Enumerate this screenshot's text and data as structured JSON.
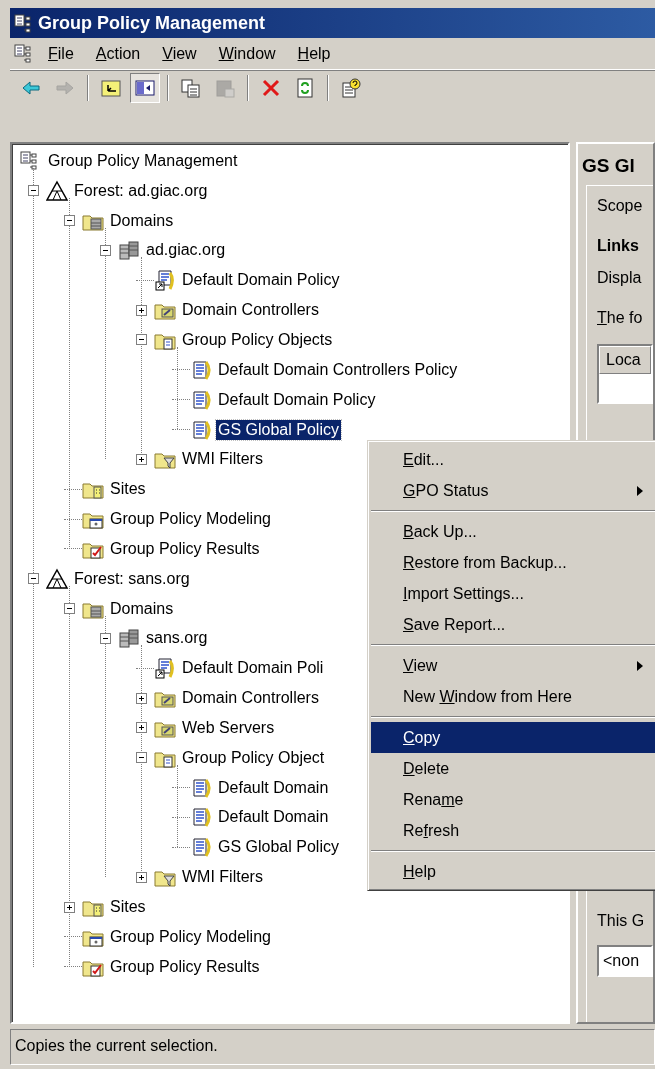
{
  "window": {
    "title": "Group Policy Management"
  },
  "menu_bar": [
    {
      "key": "F",
      "post": "ile"
    },
    {
      "key": "A",
      "post": "ction"
    },
    {
      "key": "V",
      "post": "iew"
    },
    {
      "key": "W",
      "post": "indow"
    },
    {
      "key": "H",
      "post": "elp"
    }
  ],
  "toolbar": [
    {
      "kind": "back",
      "disabled": false,
      "pressed": false
    },
    {
      "kind": "forward",
      "disabled": true,
      "pressed": false
    },
    {
      "kind": "separator"
    },
    {
      "kind": "up",
      "disabled": false,
      "pressed": false
    },
    {
      "kind": "show-tree",
      "disabled": false,
      "pressed": true
    },
    {
      "kind": "separator"
    },
    {
      "kind": "copy",
      "disabled": false,
      "pressed": false
    },
    {
      "kind": "paste",
      "disabled": true,
      "pressed": false
    },
    {
      "kind": "separator"
    },
    {
      "kind": "delete",
      "disabled": false,
      "pressed": false
    },
    {
      "kind": "refresh",
      "disabled": false,
      "pressed": false
    },
    {
      "kind": "separator"
    },
    {
      "kind": "help",
      "disabled": false,
      "pressed": false
    }
  ],
  "tree": [
    {
      "label": "Group Policy Management",
      "kind": "root",
      "selected": false,
      "children": [
        {
          "label": "Forest: ad.giac.org",
          "kind": "forest",
          "expanded": true,
          "selected": false,
          "children": [
            {
              "label": "Domains",
              "kind": "domains",
              "expanded": true,
              "selected": false,
              "children": [
                {
                  "label": "ad.giac.org",
                  "kind": "domain",
                  "expanded": true,
                  "selected": false,
                  "children": [
                    {
                      "label": "Default Domain Policy",
                      "kind": "gpo-link",
                      "selected": false
                    },
                    {
                      "label": "Domain Controllers",
                      "kind": "ou",
                      "expanded": false,
                      "selected": false
                    },
                    {
                      "label": "Group Policy Objects",
                      "kind": "gpo-folder",
                      "expanded": true,
                      "selected": false,
                      "children": [
                        {
                          "label": "Default Domain Controllers Policy",
                          "kind": "gpo",
                          "selected": false
                        },
                        {
                          "label": "Default Domain Policy",
                          "kind": "gpo",
                          "selected": false
                        },
                        {
                          "label": "GS Global Policy",
                          "kind": "gpo",
                          "selected": true
                        }
                      ]
                    },
                    {
                      "label": "WMI Filters",
                      "kind": "wmi",
                      "expanded": false,
                      "selected": false
                    }
                  ]
                }
              ]
            },
            {
              "label": "Sites",
              "kind": "sites",
              "selected": false
            },
            {
              "label": "Group Policy Modeling",
              "kind": "modeling",
              "selected": false
            },
            {
              "label": "Group Policy Results",
              "kind": "results",
              "selected": false
            }
          ]
        },
        {
          "label": "Forest: sans.org",
          "kind": "forest",
          "expanded": true,
          "selected": false,
          "children": [
            {
              "label": "Domains",
              "kind": "domains",
              "expanded": true,
              "selected": false,
              "children": [
                {
                  "label": "sans.org",
                  "kind": "domain",
                  "expanded": true,
                  "selected": false,
                  "children": [
                    {
                      "label": "Default Domain Poli",
                      "kind": "gpo-link",
                      "selected": false
                    },
                    {
                      "label": "Domain Controllers",
                      "kind": "ou",
                      "expanded": false,
                      "selected": false
                    },
                    {
                      "label": "Web Servers",
                      "kind": "ou",
                      "expanded": false,
                      "selected": false
                    },
                    {
                      "label": "Group Policy Object",
                      "kind": "gpo-folder",
                      "expanded": true,
                      "selected": false,
                      "children": [
                        {
                          "label": "Default Domain",
                          "kind": "gpo",
                          "selected": false
                        },
                        {
                          "label": "Default Domain",
                          "kind": "gpo",
                          "selected": false
                        },
                        {
                          "label": "GS Global Policy",
                          "kind": "gpo",
                          "selected": false
                        }
                      ]
                    },
                    {
                      "label": "WMI Filters",
                      "kind": "wmi",
                      "expanded": false,
                      "selected": false
                    }
                  ]
                }
              ]
            },
            {
              "label": "Sites",
              "kind": "sites",
              "expanded": false,
              "selected": false
            },
            {
              "label": "Group Policy Modeling",
              "kind": "modeling",
              "selected": false
            },
            {
              "label": "Group Policy Results",
              "kind": "results",
              "selected": false
            }
          ]
        }
      ]
    }
  ],
  "details": {
    "title": "GS Gl",
    "tab": "Scope",
    "heading": "Links",
    "text": "Displa",
    "list_label": {
      "key": "T",
      "post": "he fo"
    },
    "column": "Loca",
    "footer_label": "This G",
    "footer_value": "<non"
  },
  "context_menu": [
    {
      "kind": "item",
      "key": "E",
      "post": "dit...",
      "submenu": false,
      "selected": false
    },
    {
      "kind": "item",
      "key": "G",
      "post": "PO Status",
      "submenu": true,
      "selected": false
    },
    {
      "kind": "separator"
    },
    {
      "kind": "item",
      "key": "B",
      "post": "ack Up...",
      "submenu": false,
      "selected": false
    },
    {
      "kind": "item",
      "key": "R",
      "post": "estore from Backup...",
      "submenu": false,
      "selected": false
    },
    {
      "kind": "item",
      "key": "I",
      "post": "mport Settings...",
      "submenu": false,
      "selected": false
    },
    {
      "kind": "item",
      "key": "S",
      "post": "ave Report...",
      "submenu": false,
      "selected": false
    },
    {
      "kind": "separator"
    },
    {
      "kind": "item",
      "key": "V",
      "post": "iew",
      "submenu": true,
      "selected": false
    },
    {
      "kind": "item",
      "pre": "New ",
      "key": "W",
      "post": "indow from Here",
      "submenu": false,
      "selected": false
    },
    {
      "kind": "separator"
    },
    {
      "kind": "item",
      "key": "C",
      "post": "opy",
      "submenu": false,
      "selected": true
    },
    {
      "kind": "item",
      "key": "D",
      "post": "elete",
      "submenu": false,
      "selected": false
    },
    {
      "kind": "item",
      "pre": "Rena",
      "key": "m",
      "post": "e",
      "submenu": false,
      "selected": false
    },
    {
      "kind": "item",
      "pre": "Re",
      "key": "f",
      "post": "resh",
      "submenu": false,
      "selected": false
    },
    {
      "kind": "separator"
    },
    {
      "kind": "item",
      "key": "H",
      "post": "elp",
      "submenu": false,
      "selected": false
    }
  ],
  "status_bar": "Copies the current selection."
}
